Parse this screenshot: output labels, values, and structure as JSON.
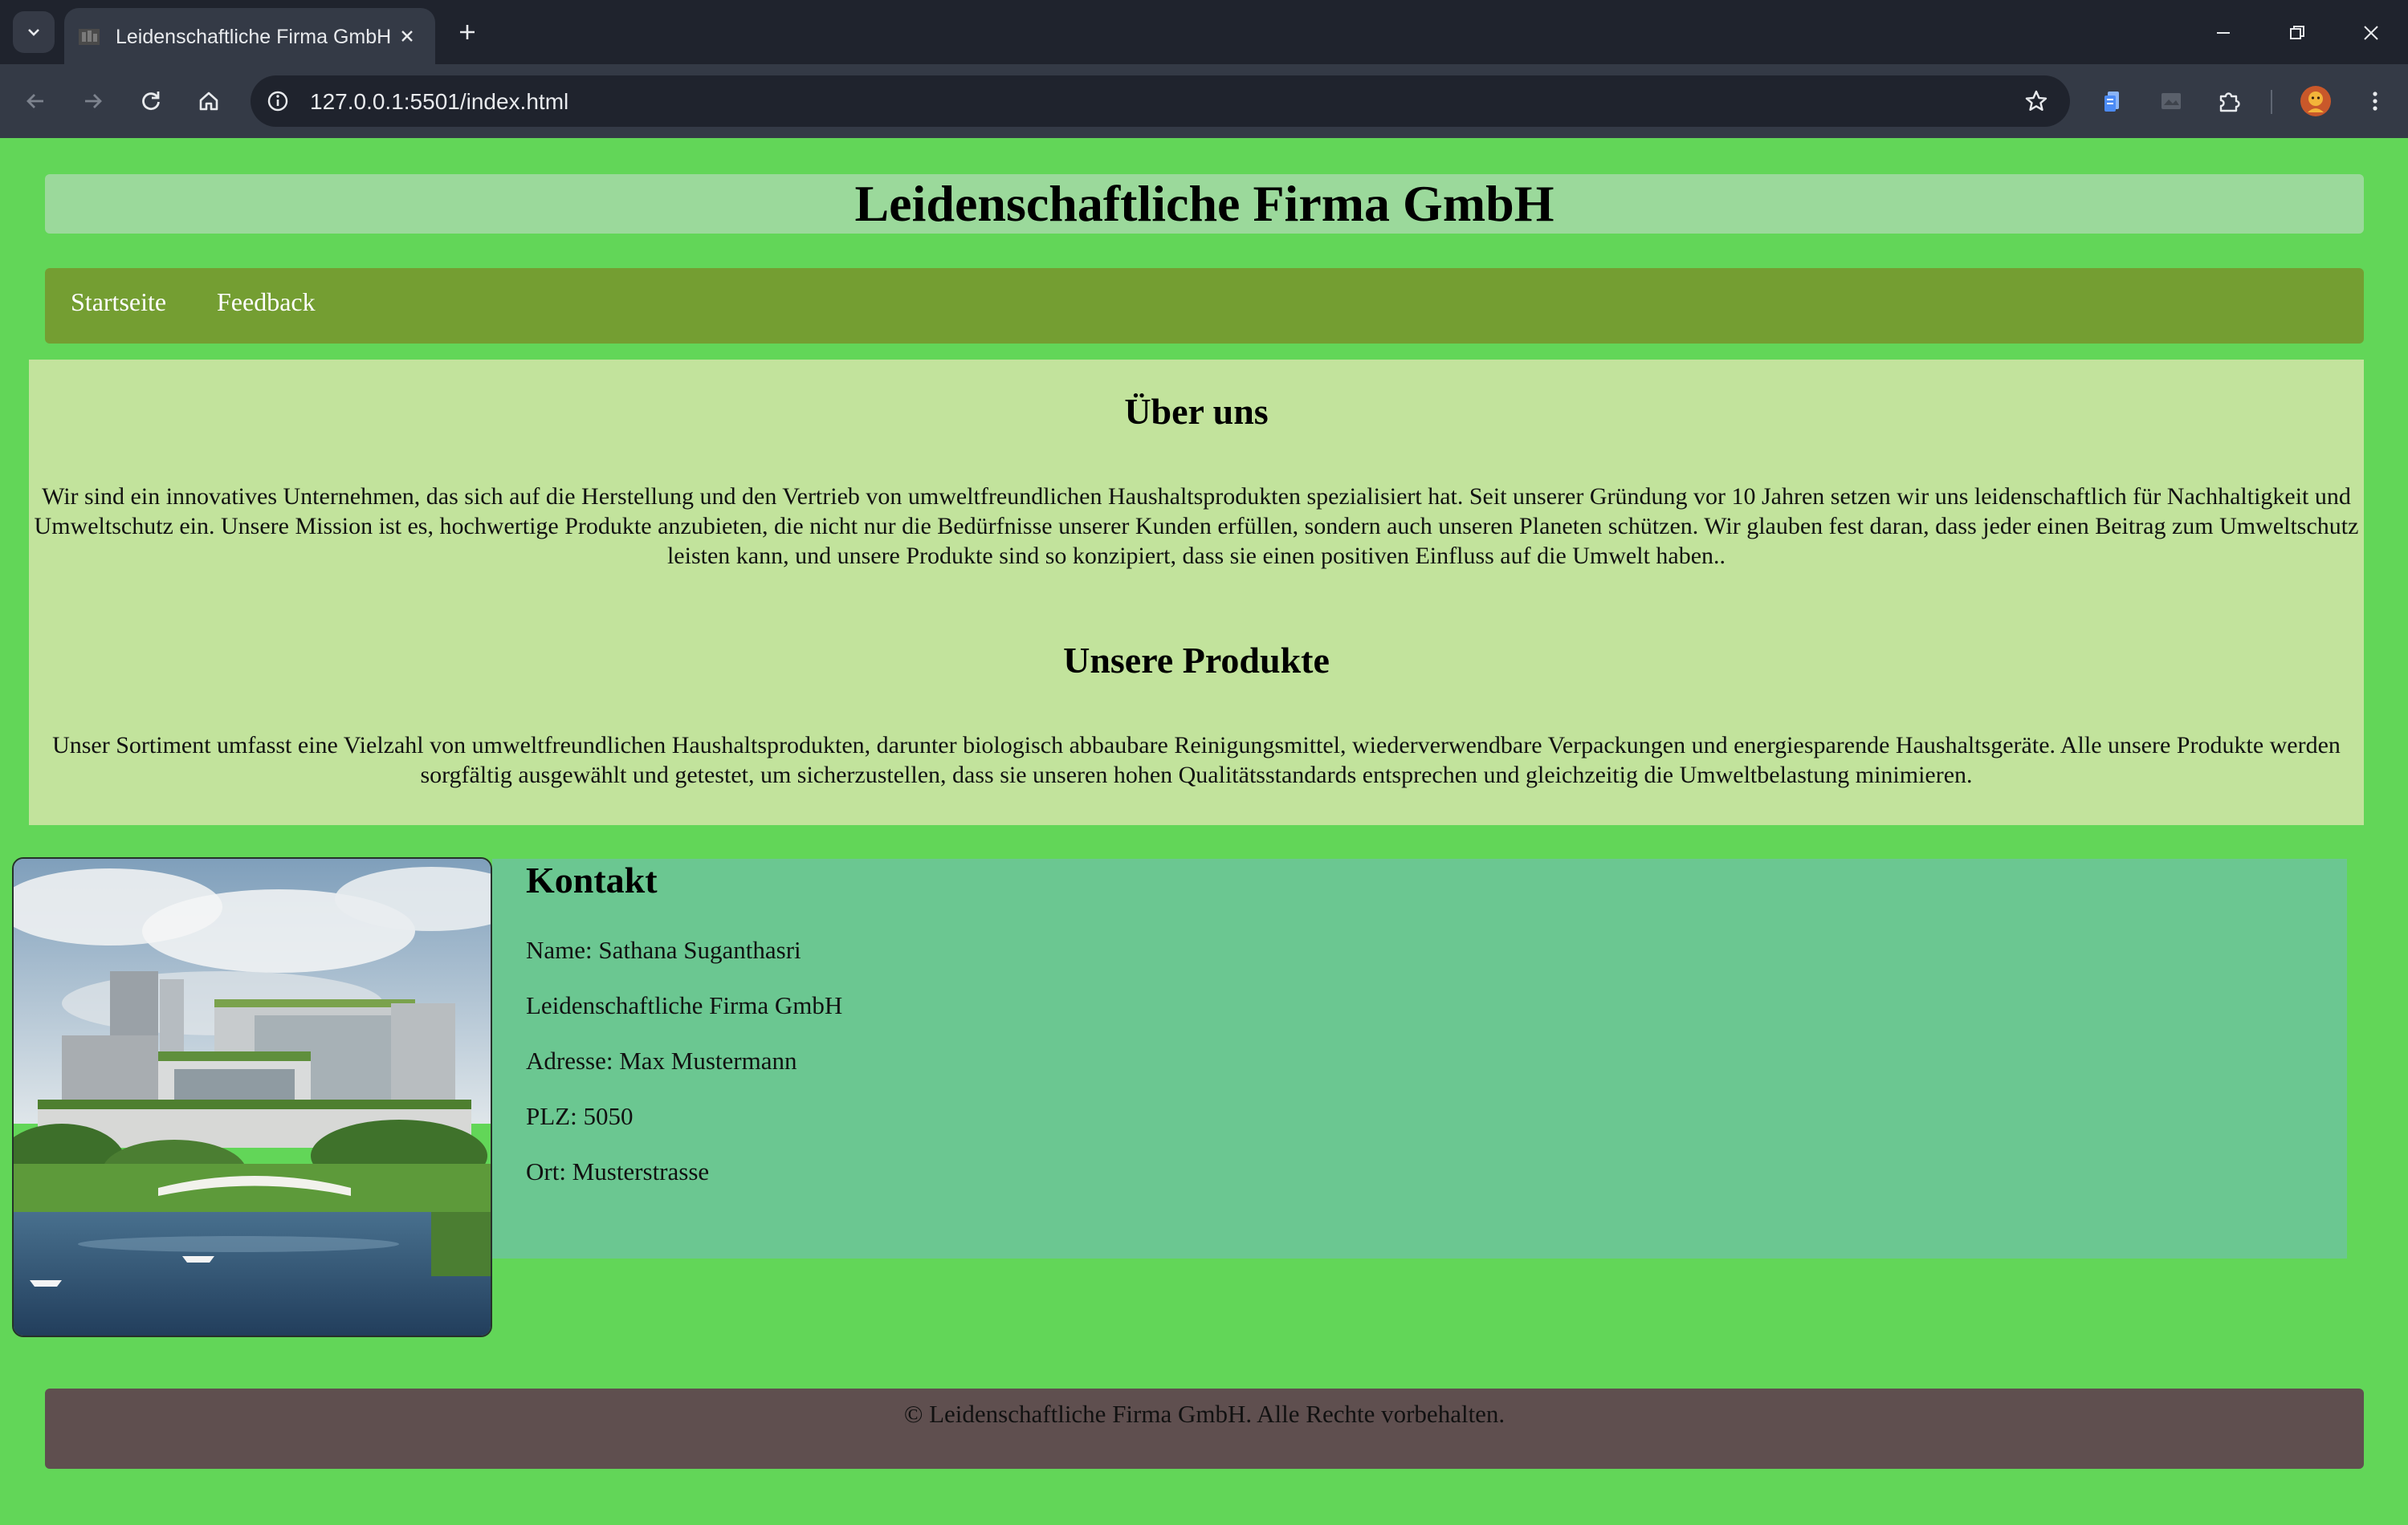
{
  "browser": {
    "tab_title": "Leidenschaftliche Firma GmbH",
    "url": "127.0.0.1:5501/index.html"
  },
  "site": {
    "title": "Leidenschaftliche Firma GmbH",
    "nav": [
      "Startseite",
      "Feedback"
    ]
  },
  "about": {
    "heading": "Über uns",
    "text": "Wir sind ein innovatives Unternehmen, das sich auf die Herstellung und den Vertrieb von umweltfreundlichen Haushaltsprodukten spezialisiert hat. Seit unserer Gründung vor 10 Jahren setzen wir uns leidenschaftlich für Nachhaltigkeit und Umweltschutz ein. Unsere Mission ist es, hochwertige Produkte anzubieten, die nicht nur die Bedürfnisse unserer Kunden erfüllen, sondern auch unseren Planeten schützen. Wir glauben fest daran, dass jeder einen Beitrag zum Umweltschutz leisten kann, und unsere Produkte sind so konzipiert, dass sie einen positiven Einfluss auf die Umwelt haben.."
  },
  "products": {
    "heading": "Unsere Produkte",
    "text": "Unser Sortiment umfasst eine Vielzahl von umweltfreundlichen Haushaltsprodukten, darunter biologisch abbaubare Reinigungsmittel, wiederverwendbare Verpackungen und energiesparende Haushaltsgeräte. Alle unsere Produkte werden sorgfältig ausgewählt und getestet, um sicherzustellen, dass sie unseren hohen Qualitätsstandards entsprechen und gleichzeitig die Umweltbelastung minimieren."
  },
  "contact": {
    "heading": "Kontakt",
    "name": "Name: Sathana Suganthasri",
    "company": "Leidenschaftliche Firma GmbH",
    "address": "Adresse: Max Mustermann",
    "plz": "PLZ: 5050",
    "ort": "Ort: Musterstrasse"
  },
  "footer": {
    "text": "© Leidenschaftliche Firma GmbH. Alle Rechte vorbehalten."
  },
  "colors": {
    "page_bg": "#62d658",
    "header_bg": "#9bd99b",
    "nav_bg": "#749e32",
    "content_bg": "#c2e39c",
    "contact_bg": "#6bc791",
    "footer_bg": "#5f4f4f"
  },
  "icons": [
    "tab-search-icon",
    "favicon-icon",
    "close-icon",
    "plus-icon",
    "minimize-icon",
    "restore-icon",
    "window-close-icon",
    "back-icon",
    "forward-icon",
    "reload-icon",
    "home-icon",
    "site-info-icon",
    "bookmark-star-icon",
    "extension-icon",
    "puzzle-icon",
    "profile-avatar-icon",
    "menu-dots-icon"
  ]
}
